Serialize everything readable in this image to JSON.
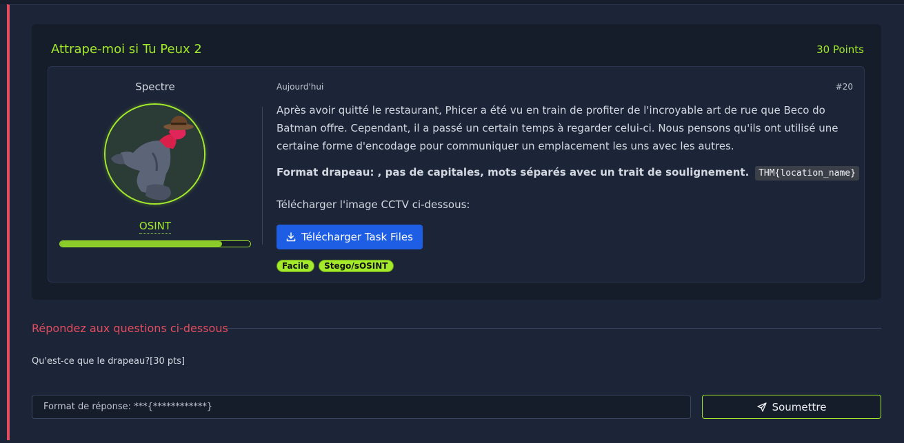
{
  "task": {
    "title": "Attrape-moi si Tu Peux 2",
    "points": "30 Points"
  },
  "author": {
    "name": "Spectre",
    "role": "OSINT",
    "progress": 0.85
  },
  "post": {
    "date": "Aujourd'hui",
    "number": "#20",
    "description": "Après avoir quitté le restaurant, Phicer a été vu en train de profiter de l'incroyable art de rue que Beco do Batman offre. Cependant, il a passé un certain temps à regarder celui-ci. Nous pensons qu'ils ont utilisé une certaine forme d'encodage pour communiquer un emplacement les uns avec les autres.",
    "format_label": "Format drapeau: , pas de capitales, mots séparés avec un trait de soulignement.",
    "format_code": "THM{location_name}",
    "download_text": "Télécharger l'image CCTV ci-dessous:",
    "download_button": "Télécharger Task Files",
    "tags": [
      "Facile",
      "Stego/sOSINT"
    ]
  },
  "answers": {
    "section_title": "Répondez aux questions ci-dessous",
    "question": "Qu'est-ce que le drapeau?[30 pts]",
    "placeholder": "Format de réponse: ***{************}",
    "submit_label": "Soumettre"
  },
  "colors": {
    "accent_green": "#a3ea2a",
    "accent_red": "#e44d5f",
    "button_blue": "#1e5ee5"
  }
}
